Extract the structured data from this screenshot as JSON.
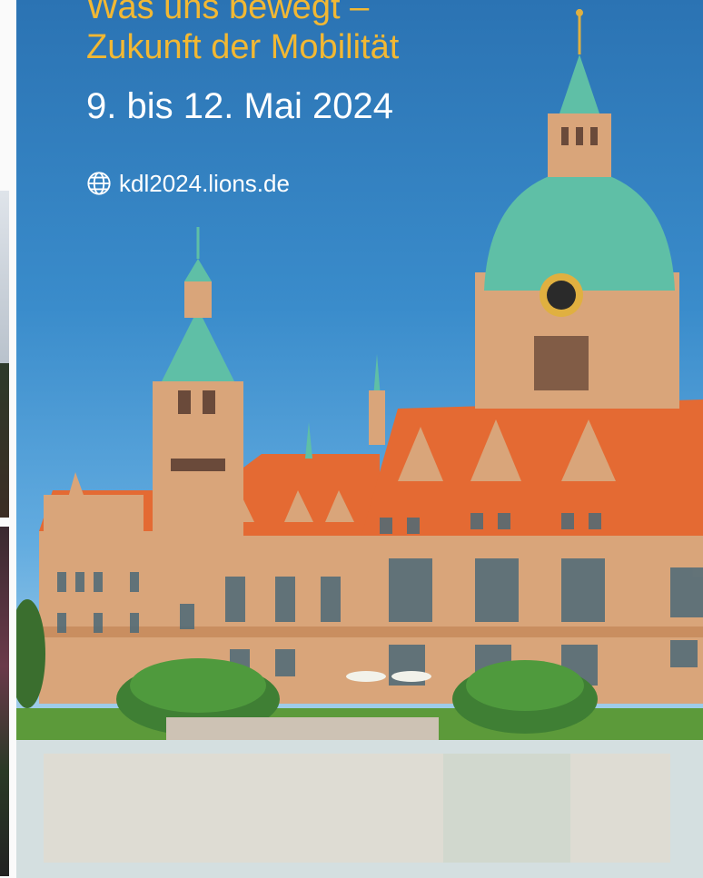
{
  "poster": {
    "title_line1": "Was uns bewegt –",
    "title_line2": "Zukunft der Mobilität",
    "dates": "9. bis 12. Mai 2024",
    "website": "kdl2024.lions.de",
    "website_icon": "globe-icon"
  },
  "colors": {
    "title": "#f2b833",
    "text": "#ffffff",
    "sky_top": "#2b73b3",
    "sky_bottom": "#cfe3ef",
    "roof": "#e46a33",
    "dome": "#5fbfa6",
    "facade": "#d9a57a",
    "grass": "#5c9a3a"
  }
}
